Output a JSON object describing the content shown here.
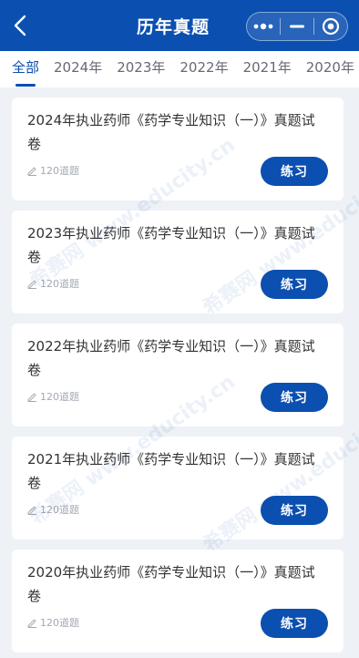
{
  "header": {
    "title": "历年真题",
    "back_icon": "chevron-left-icon",
    "menu_icon": "more-dots-icon",
    "minimize_icon": "minus-icon",
    "close_icon": "target-circle-icon"
  },
  "tabs": [
    {
      "label": "全部",
      "active": true
    },
    {
      "label": "2024年",
      "active": false
    },
    {
      "label": "2023年",
      "active": false
    },
    {
      "label": "2022年",
      "active": false
    },
    {
      "label": "2021年",
      "active": false
    },
    {
      "label": "2020年",
      "active": false
    }
  ],
  "papers": [
    {
      "title": "2024年执业药师《药学专业知识（一）》真题试卷",
      "count": "120道题",
      "action": "练习"
    },
    {
      "title": "2023年执业药师《药学专业知识（一）》真题试卷",
      "count": "120道题",
      "action": "练习"
    },
    {
      "title": "2022年执业药师《药学专业知识（一）》真题试卷",
      "count": "120道题",
      "action": "练习"
    },
    {
      "title": "2021年执业药师《药学专业知识（一）》真题试卷",
      "count": "120道题",
      "action": "练习"
    },
    {
      "title": "2020年执业药师《药学专业知识（一）》真题试卷",
      "count": "120道题",
      "action": "练习"
    }
  ],
  "watermark": {
    "text": "希赛网 www.educity.cn"
  },
  "colors": {
    "brand": "#0b4fb0",
    "background": "#eef1f6"
  }
}
